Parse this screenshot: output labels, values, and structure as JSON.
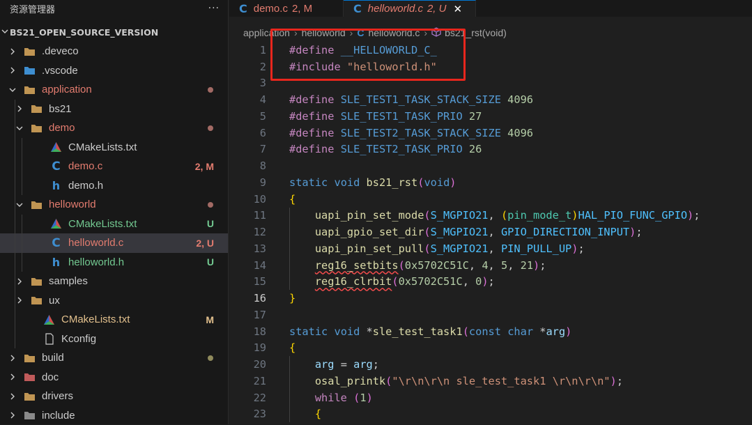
{
  "sidebar": {
    "title": "资源管理器",
    "more_label": "···",
    "root_label": "BS21_OPEN_SOURCE_VERSION",
    "items": [
      {
        "label": ".deveco",
        "icon": "folder-icon",
        "status": ""
      },
      {
        "label": ".vscode",
        "icon": "vscode-folder-icon",
        "status": ""
      },
      {
        "label": "application",
        "icon": "folder-open-icon",
        "status": "dot"
      },
      {
        "label": "bs21",
        "icon": "folder-icon",
        "status": ""
      },
      {
        "label": "demo",
        "icon": "folder-open-icon",
        "status": "dot"
      },
      {
        "label": "CMakeLists.txt",
        "icon": "cmake-icon",
        "status": ""
      },
      {
        "label": "demo.c",
        "icon": "c-file-icon",
        "status": "2, M"
      },
      {
        "label": "demo.h",
        "icon": "h-file-icon",
        "status": ""
      },
      {
        "label": "helloworld",
        "icon": "folder-open-icon",
        "status": "dot"
      },
      {
        "label": "CMakeLists.txt",
        "icon": "cmake-icon",
        "status": "U"
      },
      {
        "label": "helloworld.c",
        "icon": "c-file-icon",
        "status": "2, U"
      },
      {
        "label": "helloworld.h",
        "icon": "h-file-icon",
        "status": "U"
      },
      {
        "label": "samples",
        "icon": "folder-icon",
        "status": ""
      },
      {
        "label": "ux",
        "icon": "folder-icon",
        "status": ""
      },
      {
        "label": "CMakeLists.txt",
        "icon": "cmake-icon",
        "status": "M"
      },
      {
        "label": "Kconfig",
        "icon": "file-icon",
        "status": ""
      },
      {
        "label": "build",
        "icon": "build-folder-icon",
        "status": "dot"
      },
      {
        "label": "doc",
        "icon": "doc-folder-icon",
        "status": ""
      },
      {
        "label": "drivers",
        "icon": "folder-icon",
        "status": ""
      },
      {
        "label": "include",
        "icon": "include-folder-icon",
        "status": ""
      }
    ]
  },
  "tabs": [
    {
      "icon": "c-file-icon",
      "label": "demo.c",
      "status": "2, M",
      "active": false
    },
    {
      "icon": "c-file-icon",
      "label": "helloworld.c",
      "status": "2, U",
      "active": true,
      "close": "✕"
    }
  ],
  "breadcrumb": [
    "application",
    "helloworld",
    "helloworld.c",
    "bs21_rst(void)"
  ],
  "breadcrumb_sep": "›",
  "code_lines": [
    {
      "n": "1",
      "text": "#define __HELLOWORLD_C_"
    },
    {
      "n": "2",
      "text": "#include \"helloworld.h\""
    },
    {
      "n": "3",
      "text": ""
    },
    {
      "n": "4",
      "text": "#define SLE_TEST1_TASK_STACK_SIZE 4096"
    },
    {
      "n": "5",
      "text": "#define SLE_TEST1_TASK_PRIO 27"
    },
    {
      "n": "6",
      "text": "#define SLE_TEST2_TASK_STACK_SIZE 4096"
    },
    {
      "n": "7",
      "text": "#define SLE_TEST2_TASK_PRIO 26"
    },
    {
      "n": "8",
      "text": ""
    },
    {
      "n": "9",
      "text": "static void bs21_rst(void)"
    },
    {
      "n": "10",
      "text": "{"
    },
    {
      "n": "11",
      "text": "    uapi_pin_set_mode(S_MGPIO21, (pin_mode_t)HAL_PIO_FUNC_GPIO);"
    },
    {
      "n": "12",
      "text": "    uapi_gpio_set_dir(S_MGPIO21, GPIO_DIRECTION_INPUT);"
    },
    {
      "n": "13",
      "text": "    uapi_pin_set_pull(S_MGPIO21, PIN_PULL_UP);"
    },
    {
      "n": "14",
      "text": "    reg16_setbits(0x5702C51C, 4, 5, 21);"
    },
    {
      "n": "15",
      "text": "    reg16_clrbit(0x5702C51C, 0);"
    },
    {
      "n": "16",
      "text": "}"
    },
    {
      "n": "17",
      "text": ""
    },
    {
      "n": "18",
      "text": "static void *sle_test_task1(const char *arg)"
    },
    {
      "n": "19",
      "text": "{"
    },
    {
      "n": "20",
      "text": "    arg = arg;"
    },
    {
      "n": "21",
      "text": "    osal_printk(\"\\r\\n\\r\\n sle_test_task1 \\r\\n\\r\\n\");"
    },
    {
      "n": "22",
      "text": "    while (1)"
    },
    {
      "n": "23",
      "text": "    {"
    }
  ],
  "current_line": "16",
  "colors": {
    "accent": "#0078d4",
    "modified": "#e37c6f",
    "untracked": "#73c991",
    "annotation_box": "#e8261d"
  }
}
